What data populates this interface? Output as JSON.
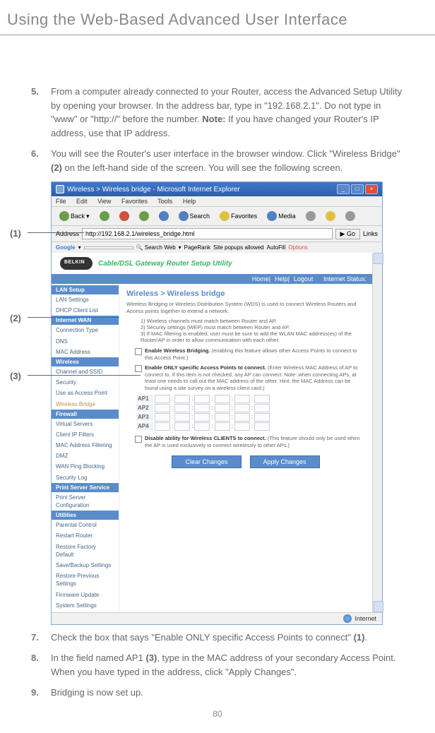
{
  "header": {
    "chapter_title": "Using the Web-Based Advanced User Interface"
  },
  "steps": {
    "s5": {
      "num": "5.",
      "body_before_note": "From a computer already connected to your Router, access the Advanced Setup Utility by opening your browser. In the address bar, type in \"192.168.2.1\". Do not type in \"www\" or \"http://\" before the number. ",
      "note_label": "Note:",
      "body_after_note": " If you have changed your Router's IP address, use that IP address."
    },
    "s6": {
      "num": "6.",
      "body_a": "You will see the Router's user interface in the browser window. Click \"Wireless Bridge\" ",
      "bold_a": "(2)",
      "body_b": " on the left-hand side of the screen. You will see the following screen."
    },
    "s7": {
      "num": "7.",
      "body_a": "Check the box that says \"Enable ONLY specific Access Points to connect\" ",
      "bold_a": "(1)",
      "body_b": "."
    },
    "s8": {
      "num": "8.",
      "body_a": "In the field named AP1 ",
      "bold_a": "(3)",
      "body_b": ", type in the MAC address of your secondary Access Point. When you have typed in the address, click \"Apply Changes\"."
    },
    "s9": {
      "num": "9.",
      "body": "Bridging is now set up."
    }
  },
  "callouts": {
    "c1": "(1)",
    "c2": "(2)",
    "c3": "(3)"
  },
  "screenshot": {
    "titlebar": "Wireless > Wireless bridge - Microsoft Internet Explorer",
    "menu": {
      "file": "File",
      "edit": "Edit",
      "view": "View",
      "favorites": "Favorites",
      "tools": "Tools",
      "help": "Help"
    },
    "toolbar": {
      "back": "Back",
      "search": "Search",
      "favorites": "Favorites",
      "media": "Media"
    },
    "address_label": "Address",
    "address_value": "http://192.168.2.1/wireless_bridge.html",
    "go": "Go",
    "links": "Links",
    "google": {
      "brand": "Google",
      "search_web": "Search Web",
      "pagerank": "PageRank",
      "popups": "Site popups allowed",
      "autofill": "AutoFill",
      "options": "Options"
    },
    "utility_title": "Cable/DSL Gateway Router Setup Utility",
    "nav": {
      "home": "Home",
      "help": "Help",
      "logout": "Logout",
      "status": "Internet Status:"
    },
    "sidebar": {
      "lan_setup": "LAN Setup",
      "lan_settings": "LAN Settings",
      "dhcp_list": "DHCP Client List",
      "internet_wan": "Internet WAN",
      "conn_type": "Connection Type",
      "dns": "DNS",
      "mac_addr": "MAC Address",
      "wireless": "Wireless",
      "channel_ssid": "Channel and SSID",
      "security": "Security",
      "use_ap": "Use as Access Point",
      "wireless_bridge": "Wireless Bridge",
      "firewall": "Firewall",
      "vservers": "Virtual Servers",
      "client_ip": "Client IP Filters",
      "mac_filter": "MAC Address Filtering",
      "dmz": "DMZ",
      "wan_ping": "WAN Ping Blocking",
      "sec_log": "Security Log",
      "print_srv": "Print Server Service",
      "print_conf": "Print Server Configuration",
      "utilities": "Utilities",
      "parental": "Parental Control",
      "restart": "Restart Router",
      "factory": "Restore Factory Default",
      "save": "Save/Backup Settings",
      "restore": "Restore Previous Settings",
      "firmware": "Firmware Update",
      "system": "System Settings"
    },
    "panel": {
      "title": "Wireless > Wireless bridge",
      "intro": "Wireless Bridging or Wireless Distribution System (WDS) is used to connect Wireless Routers and Access points together to extend a network.",
      "item1": "1) Wireless channels must match between Router and AP.",
      "item2": "2) Security  settings (WEP) must match between Router and AP.",
      "item3": "3) If MAC filtering is enabled, user must be sure to add the WLAN MAC address(es) of the Router/AP in order to allow communication with each other.",
      "enable_bridge_b": "Enable Wireless Bridging.",
      "enable_bridge_t": " (enabling this feature allows other Access Points to connect to this Access Point.)",
      "enable_only_b": "Enable ONLY specific Access Points to connect.",
      "enable_only_t": " (Enter Wireless MAC Address of AP to connect to. If this item is not checked, any AP can connect. Note: when connecting APs, at least one needs to call out the MAC address of the other. Hint: the MAC Address can be found using a site survey on a wireless client card.)",
      "ap1": "AP1",
      "ap2": "AP2",
      "ap3": "AP3",
      "ap4": "AP4",
      "disable_b": "Disable ability for Wireless CLIENTS to connect.",
      "disable_t": " (This feature should only be used when the AP is used exclusively to connect wirelessly to other APs.)",
      "clear": "Clear Changes",
      "apply": "Apply Changes"
    },
    "statusbar": "Internet"
  },
  "page_number": "80"
}
